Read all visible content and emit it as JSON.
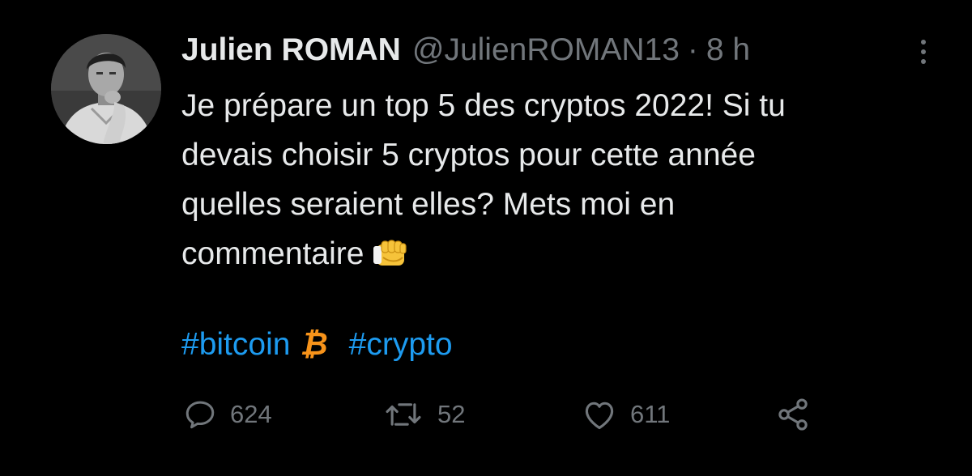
{
  "tweet": {
    "author": {
      "display_name": "Julien ROMAN",
      "handle": "@JulienROMAN13",
      "avatar_icon": "profile-photo"
    },
    "separator": "·",
    "time": "8 h",
    "body_lines": [
      "Je prépare un top 5 des cryptos 2022! Si tu",
      "devais choisir 5 cryptos pour cette année",
      "quelles seraient elles? Mets moi en",
      "commentaire"
    ],
    "body_emoji": "fist-bump-emoji",
    "hashtags": [
      {
        "text": "#bitcoin",
        "emoji": "₿"
      },
      {
        "text": "#crypto"
      }
    ],
    "actions": {
      "replies": "624",
      "retweets": "52",
      "likes": "611",
      "share_icon": "share-icon"
    }
  },
  "colors": {
    "background": "#000000",
    "text": "#e7e9ea",
    "muted": "#71767b",
    "link": "#1d9bf0",
    "bitcoin": "#f7931a"
  }
}
